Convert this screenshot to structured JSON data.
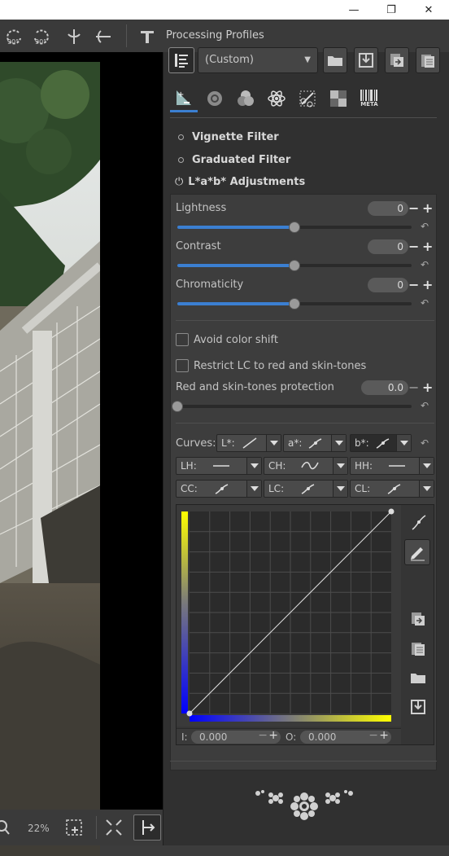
{
  "window": {
    "minimize": "—",
    "maximize": "❐",
    "close": "✕"
  },
  "toolbar": {
    "rotate_left": "90°",
    "rotate_right": "90°"
  },
  "profiles": {
    "title": "Processing Profiles",
    "selected": "(Custom)"
  },
  "tabs": [
    {
      "icon": "exposure-icon"
    },
    {
      "icon": "detail-icon"
    },
    {
      "icon": "color-icon"
    },
    {
      "icon": "advanced-icon"
    },
    {
      "icon": "transform-icon"
    },
    {
      "icon": "raw-icon"
    },
    {
      "icon": "metadata-icon",
      "label": "META"
    }
  ],
  "sections": {
    "vignette": "Vignette Filter",
    "graduated": "Graduated Filter",
    "lab": "L*a*b* Adjustments"
  },
  "lab": {
    "lightness": {
      "label": "Lightness",
      "value": "0",
      "fraction": 0.5
    },
    "contrast": {
      "label": "Contrast",
      "value": "0",
      "fraction": 0.5
    },
    "chromaticity": {
      "label": "Chromaticity",
      "value": "0",
      "fraction": 0.5
    },
    "avoid_shift": "Avoid color shift",
    "restrict_lc": "Restrict LC to red and skin-tones",
    "protection": {
      "label": "Red and skin-tones protection",
      "value": "0.0",
      "fraction": 0.0
    }
  },
  "curves": {
    "label": "Curves:",
    "buttons": [
      {
        "label": "L*:",
        "icon": "linear-curve-icon"
      },
      {
        "label": "a*:",
        "icon": "custom-curve-icon"
      },
      {
        "label": "b*:",
        "icon": "custom-curve-icon"
      },
      {
        "label": "LH:",
        "icon": "flat-curve-icon"
      },
      {
        "label": "CH:",
        "icon": "wave-curve-icon"
      },
      {
        "label": "HH:",
        "icon": "flat-curve-icon"
      },
      {
        "label": "CC:",
        "icon": "custom-curve-icon"
      },
      {
        "label": "LC:",
        "icon": "custom-curve-icon"
      },
      {
        "label": "CL:",
        "icon": "custom-curve-icon"
      }
    ],
    "input_label": "I:",
    "input_value": "0.000",
    "output_label": "O:",
    "output_value": "0.000"
  },
  "zoom": "22%"
}
